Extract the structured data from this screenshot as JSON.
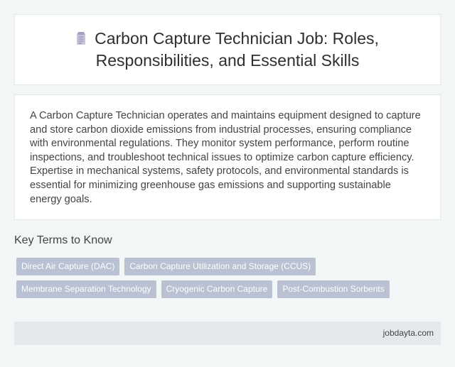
{
  "header": {
    "icon": "document-icon",
    "title": "Carbon Capture Technician Job: Roles, Responsibilities, and Essential Skills"
  },
  "summary": {
    "text": "A Carbon Capture Technician operates and maintains equipment designed to capture and store carbon dioxide emissions from industrial processes, ensuring compliance with environmental regulations. They monitor system performance, perform routine inspections, and troubleshoot technical issues to optimize carbon capture efficiency. Expertise in mechanical systems, safety protocols, and environmental standards is essential for minimizing greenhouse gas emissions and supporting sustainable energy goals."
  },
  "key_terms": {
    "heading": "Key Terms to Know",
    "rows": [
      [
        "Direct Air Capture (DAC)",
        "Carbon Capture Utilization and Storage (CCUS)"
      ],
      [
        "Membrane Separation Technology",
        "Cryogenic Carbon Capture",
        "Post-Combustion Sorbents"
      ]
    ]
  },
  "footer": {
    "source": "jobdayta.com"
  },
  "colors": {
    "background": "#f3f6f7",
    "tag": "#b9c1d2",
    "footer": "#e4eaec"
  }
}
